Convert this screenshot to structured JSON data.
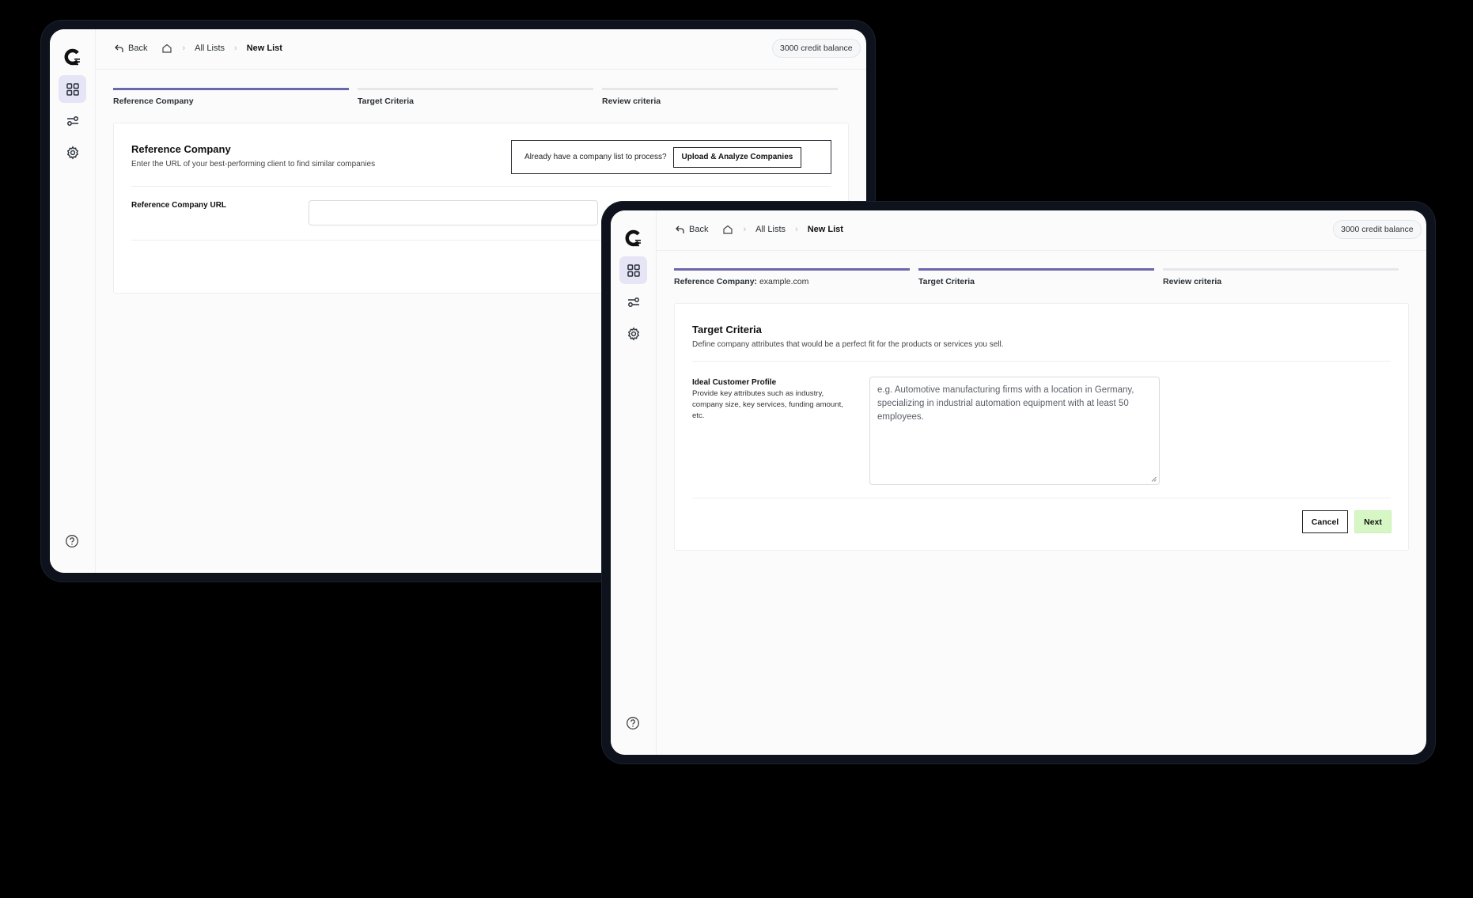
{
  "app": {
    "back_label": "Back",
    "breadcrumb_all_lists": "All Lists",
    "breadcrumb_new_list": "New List",
    "credit_balance": "3000 credit balance",
    "accent_color": "#6b67ab",
    "next_button_color": "#d6f7c4"
  },
  "back_window": {
    "steps": [
      {
        "label": "Reference Company",
        "state": "active"
      },
      {
        "label": "Target Criteria",
        "state": "pending"
      },
      {
        "label": "Review criteria",
        "state": "pending"
      }
    ],
    "card": {
      "title": "Reference Company",
      "subtitle": "Enter the URL of your best-performing client to find similar companies",
      "upload_prompt": "Already have a company list to process?",
      "upload_button": "Upload & Analyze Companies",
      "url_label": "Reference Company URL",
      "url_value": ""
    }
  },
  "front_window": {
    "steps": [
      {
        "label": "Reference Company:",
        "value": "example.com",
        "state": "done"
      },
      {
        "label": "Target Criteria",
        "state": "active"
      },
      {
        "label": "Review criteria",
        "state": "pending"
      }
    ],
    "card": {
      "title": "Target Criteria",
      "subtitle": "Define company attributes that would be a perfect fit for the products or services you sell.",
      "icp_label": "Ideal Customer Profile",
      "icp_description": "Provide key attributes such as industry, company size, key services, funding amount, etc.",
      "icp_placeholder": "e.g. Automotive manufacturing firms with a location in Germany, specializing in industrial automation equipment with at least 50 employees.",
      "cancel_button": "Cancel",
      "next_button": "Next"
    }
  },
  "icons": [
    "logo-icon",
    "dashboard-grid-icon",
    "filters-icon",
    "gear-icon",
    "help-icon",
    "back-arrow-icon",
    "home-icon",
    "chevron-right-icon",
    "user-icon"
  ]
}
